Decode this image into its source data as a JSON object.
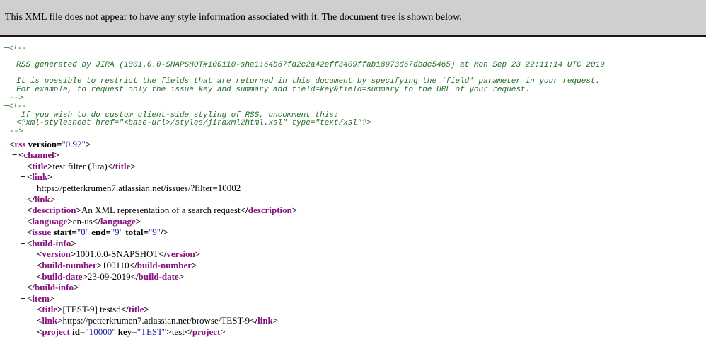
{
  "banner": "This XML file does not appear to have any style information associated with it. The document tree is shown below.",
  "comments": [
    {
      "lines": [
        "",
        "RSS generated by JIRA (1001.0.0-SNAPSHOT#100110-sha1:64b67fd2c2a42eff3409ffab18973d67dbdc5465) at Mon Sep 23 22:11:14 UTC 2019",
        "",
        "It is possible to restrict the fields that are returned in this document by specifying the 'field' parameter in your request.",
        "For example, to request only the issue key and summary add field=key&field=summary to the URL of your request."
      ]
    },
    {
      "lines": [
        " If you wish to do custom client-side styling of RSS, uncomment this:",
        "<?xml-stylesheet href=\"<base-url>/styles/jiraxml2html.xsl\" type=\"text/xsl\"?>"
      ]
    }
  ],
  "nodes": [
    {
      "level": 0,
      "toggle": true,
      "tag": "rss",
      "attrs": [
        [
          "version",
          "0.92"
        ]
      ],
      "kind": "open"
    },
    {
      "level": 1,
      "toggle": true,
      "tag": "channel",
      "kind": "open"
    },
    {
      "level": 2,
      "tag": "title",
      "text": "test filter (Jira)",
      "kind": "inline"
    },
    {
      "level": 2,
      "toggle": true,
      "tag": "link",
      "kind": "open"
    },
    {
      "level": 3,
      "text": "https://petterkrumen7.atlassian.net/issues/?filter=10002",
      "kind": "text"
    },
    {
      "level": 2,
      "tag": "link",
      "kind": "close"
    },
    {
      "level": 2,
      "tag": "description",
      "text": "An XML representation of a search request",
      "kind": "inline"
    },
    {
      "level": 2,
      "tag": "language",
      "text": "en-us",
      "kind": "inline"
    },
    {
      "level": 2,
      "tag": "issue",
      "attrs": [
        [
          "start",
          "0"
        ],
        [
          "end",
          "9"
        ],
        [
          "total",
          "9"
        ]
      ],
      "kind": "self"
    },
    {
      "level": 2,
      "toggle": true,
      "tag": "build-info",
      "kind": "open"
    },
    {
      "level": 3,
      "tag": "version",
      "text": "1001.0.0-SNAPSHOT",
      "kind": "inline"
    },
    {
      "level": 3,
      "tag": "build-number",
      "text": "100110",
      "kind": "inline"
    },
    {
      "level": 3,
      "tag": "build-date",
      "text": "23-09-2019",
      "kind": "inline"
    },
    {
      "level": 2,
      "tag": "build-info",
      "kind": "close"
    },
    {
      "level": 2,
      "toggle": true,
      "tag": "item",
      "kind": "open"
    },
    {
      "level": 3,
      "tag": "title",
      "text": "[TEST-9] testsd",
      "kind": "inline"
    },
    {
      "level": 3,
      "tag": "link",
      "text": "https://petterkrumen7.atlassian.net/browse/TEST-9",
      "kind": "inline"
    },
    {
      "level": 3,
      "tag": "project",
      "attrs": [
        [
          "id",
          "10000"
        ],
        [
          "key",
          "TEST"
        ]
      ],
      "text": "test",
      "kind": "inline"
    }
  ],
  "toggle_symbol": "−",
  "comment_open": "<!--",
  "comment_close": "-->"
}
